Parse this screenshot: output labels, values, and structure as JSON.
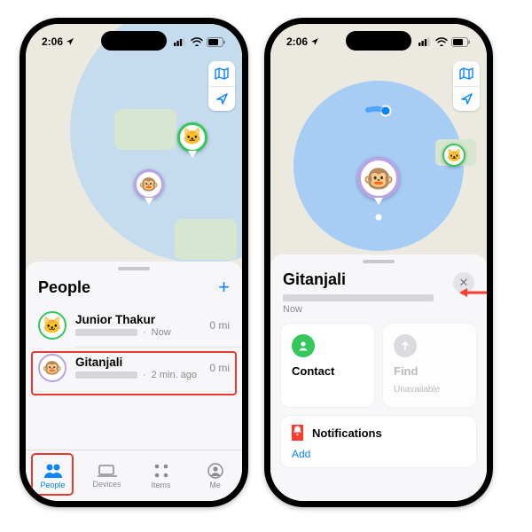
{
  "status": {
    "time": "2:06",
    "loc_arrow": "➤"
  },
  "colors": {
    "accent": "#0a84ff",
    "highlight": "#e53935",
    "muted": "#8a8a8e"
  },
  "left": {
    "sheet_title": "People",
    "add_glyph": "+",
    "people": [
      {
        "name": "Junior Thakur",
        "sub_time": "Now",
        "distance": "0 mi",
        "avatar_emoji": "🐱",
        "avatar_border": "#34c759"
      },
      {
        "name": "Gitanjali",
        "sub_time": "2 min. ago",
        "distance": "0 mi",
        "avatar_emoji": "🐵",
        "avatar_border": "#b9a4e8"
      }
    ],
    "tabs": [
      {
        "id": "people",
        "label": "People"
      },
      {
        "id": "devices",
        "label": "Devices"
      },
      {
        "id": "items",
        "label": "Items"
      },
      {
        "id": "me",
        "label": "Me"
      }
    ],
    "active_tab": "people"
  },
  "right": {
    "title": "Gitanjali",
    "now_label": "Now",
    "close_glyph": "✕",
    "cards": {
      "contact": {
        "title": "Contact",
        "icon_bg": "#34c759"
      },
      "find": {
        "title": "Find",
        "sub": "Unavailable",
        "icon_bg": "#d7d7db",
        "disabled": true
      }
    },
    "notifications": {
      "title": "Notifications",
      "add_label": "Add",
      "icon_bg": "#ff3b30"
    }
  }
}
